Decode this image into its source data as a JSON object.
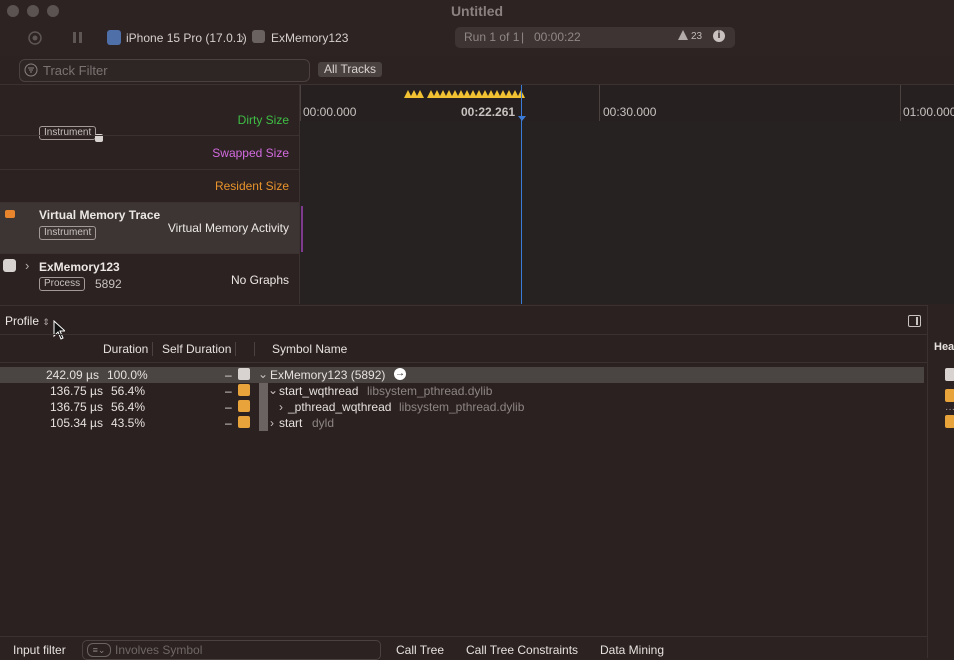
{
  "window": {
    "title": "Untitled"
  },
  "toolbar": {
    "device": "iPhone 15 Pro (17.0.1)",
    "target": "ExMemory123",
    "run": "Run 1 of 1",
    "elapsed": "00:00:22",
    "warnings": "23"
  },
  "filter": {
    "placeholder": "Track Filter",
    "all_tracks": "All Tracks"
  },
  "ruler": {
    "ticks": [
      "00:00.000",
      "00:22.261",
      "00:30.000",
      "01:00.000"
    ]
  },
  "tracks": [
    {
      "badge": "Instrument",
      "graphs": [
        "Dirty Size",
        "Swapped Size",
        "Resident Size"
      ]
    },
    {
      "name": "Virtual Memory Trace",
      "badge": "Instrument",
      "graph": "Virtual Memory Activity"
    },
    {
      "name": "ExMemory123",
      "badge": "Process",
      "pid": "5892",
      "graph": "No Graphs"
    }
  ],
  "colors": {
    "swapped": "#d36be0",
    "resident": "#e8932b",
    "dirty": "#3fbf45",
    "cursor": "#3b7bd8",
    "marker": "#f2c232"
  },
  "profile": {
    "mode": "Profile",
    "headers": {
      "duration": "Duration",
      "self": "Self Duration",
      "symbol": "Symbol Name"
    },
    "rows": [
      {
        "duration": "242.09 µs",
        "percent": "100.0%",
        "self": "–",
        "symbol": "ExMemory123 (5892)",
        "lib": ""
      },
      {
        "duration": "136.75 µs",
        "percent": "56.4%",
        "self": "–",
        "symbol": "start_wqthread",
        "lib": "libsystem_pthread.dylib"
      },
      {
        "duration": "136.75 µs",
        "percent": "56.4%",
        "self": "–",
        "symbol": "_pthread_wqthread",
        "lib": "libsystem_pthread.dylib"
      },
      {
        "duration": "105.34 µs",
        "percent": "43.5%",
        "self": "–",
        "symbol": "start",
        "lib": "dyld"
      }
    ]
  },
  "side": {
    "header": "Hea"
  },
  "footer": {
    "input_filter": "Input filter",
    "search_placeholder": "Involves Symbol",
    "tabs": [
      "Call Tree",
      "Call Tree Constraints",
      "Data Mining"
    ]
  }
}
